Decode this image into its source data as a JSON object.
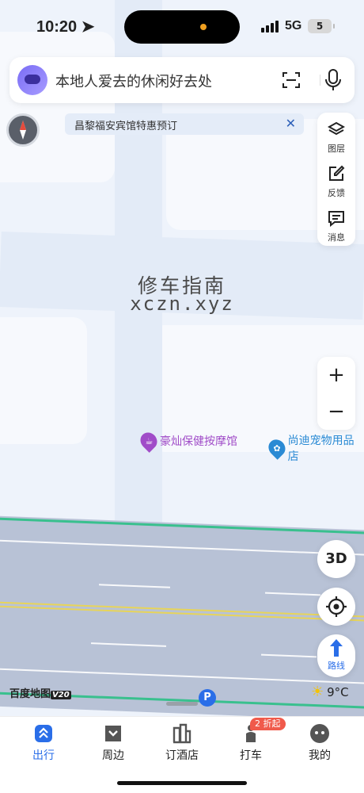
{
  "status": {
    "time": "10:20",
    "network": "5G",
    "battery": "5"
  },
  "search": {
    "placeholder": "本地人爱去的休闲好去处"
  },
  "banner": {
    "text": "昌黎福安宾馆特惠预订",
    "close": "✕"
  },
  "tools": [
    {
      "label": "图层",
      "icon": "layers-icon"
    },
    {
      "label": "反馈",
      "icon": "feedback-icon"
    },
    {
      "label": "消息",
      "icon": "message-icon"
    }
  ],
  "zoom": {
    "in": "+",
    "out": "−"
  },
  "watermark": {
    "line1": "修车指南",
    "line2": "xczn.xyz"
  },
  "pois": [
    {
      "label": "豪灿保健按摩馆",
      "color": "#a04cc8"
    },
    {
      "label": "尚迪宠物用品店",
      "color": "#2a8ad4"
    }
  ],
  "map_controls": {
    "three_d": "3D",
    "route": "路线"
  },
  "brand": {
    "name": "百度地图",
    "version": "V20"
  },
  "parking": "P",
  "weather": {
    "temp": "9°C"
  },
  "bottom_nav": [
    {
      "label": "出行",
      "active": true
    },
    {
      "label": "周边",
      "active": false
    },
    {
      "label": "订酒店",
      "active": false
    },
    {
      "label": "打车",
      "active": false
    },
    {
      "label": "我的",
      "active": false
    }
  ],
  "taxi_badge": "2 折起",
  "colors": {
    "accent": "#2a6ee8",
    "highway_edge": "#39c08e",
    "badge": "#f05a4b"
  }
}
